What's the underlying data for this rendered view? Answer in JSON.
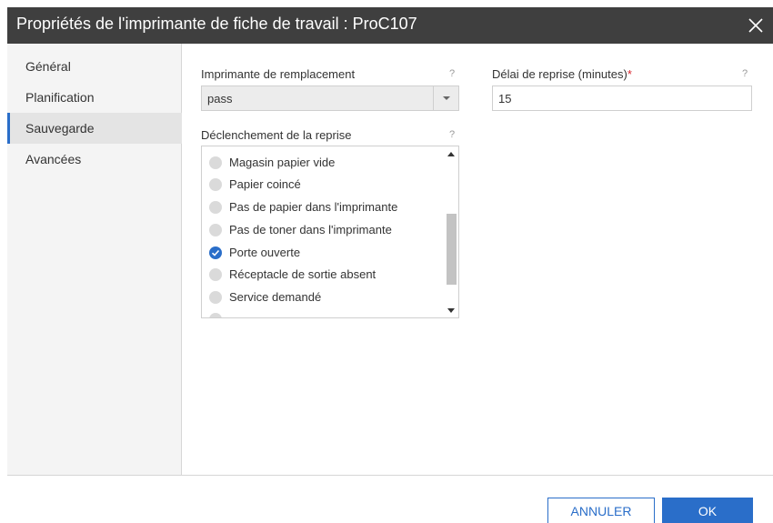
{
  "dialog": {
    "title": "Propriétés de l'imprimante de fiche de travail : ProC107"
  },
  "sidebar": {
    "items": [
      {
        "label": "Général"
      },
      {
        "label": "Planification"
      },
      {
        "label": "Sauvegarde"
      },
      {
        "label": "Avancées"
      }
    ],
    "active_index": 2
  },
  "fields": {
    "replacement_printer": {
      "label": "Imprimante de remplacement",
      "help": "?",
      "value": "pass"
    },
    "retry_delay": {
      "label": "Délai de reprise (minutes)",
      "required_mark": "*",
      "help": "?",
      "value": "15"
    },
    "trigger": {
      "label": "Déclenchement de la reprise",
      "help": "?",
      "options": [
        {
          "label": "Magasin papier vide",
          "checked": false
        },
        {
          "label": "Papier coincé",
          "checked": false
        },
        {
          "label": "Pas de papier dans l'imprimante",
          "checked": false
        },
        {
          "label": "Pas de toner dans l'imprimante",
          "checked": false
        },
        {
          "label": "Porte ouverte",
          "checked": true
        },
        {
          "label": "Réceptacle de sortie absent",
          "checked": false
        },
        {
          "label": "Service demandé",
          "checked": false
        }
      ]
    }
  },
  "footer": {
    "cancel_label": "ANNULER",
    "ok_label": "OK"
  },
  "colors": {
    "accent": "#2a6ec9",
    "titlebar": "#3f3f3f",
    "required": "#d9262f"
  }
}
